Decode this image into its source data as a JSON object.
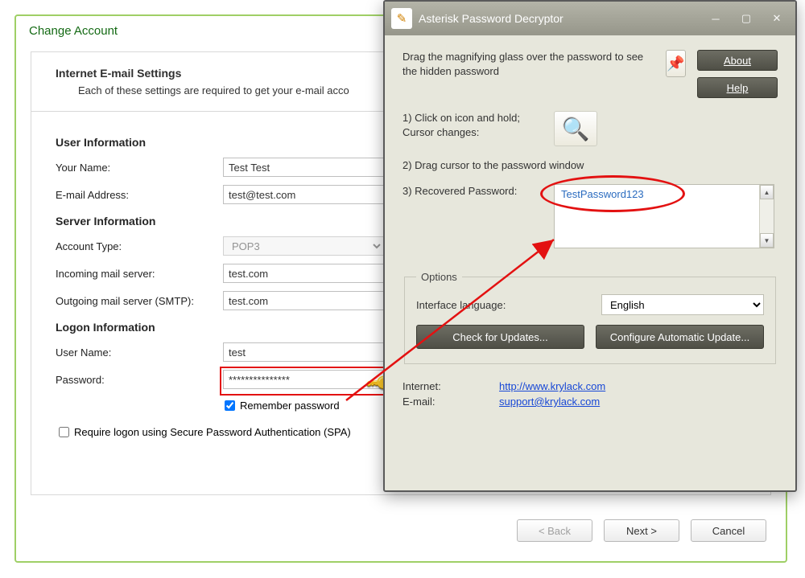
{
  "back": {
    "title": "Change Account",
    "header": "Internet E-mail Settings",
    "subheader": "Each of these settings are required to get your e-mail acco",
    "sections": {
      "user": "User Information",
      "server": "Server Information",
      "logon": "Logon Information"
    },
    "labels": {
      "your_name": "Your Name:",
      "email": "E-mail Address:",
      "account_type": "Account Type:",
      "incoming": "Incoming mail server:",
      "outgoing": "Outgoing mail server (SMTP):",
      "username": "User Name:",
      "password": "Password:",
      "remember": "Remember password",
      "spa": "Require logon using Secure Password Authentication (SPA)"
    },
    "values": {
      "your_name": "Test Test",
      "email": "test@test.com",
      "account_type": "POP3",
      "incoming": "test.com",
      "outgoing": "test.com",
      "username": "test",
      "password": "***************"
    },
    "buttons": {
      "back": "< Back",
      "next": "Next >",
      "cancel": "Cancel"
    },
    "checked": {
      "remember": true,
      "spa": false
    }
  },
  "front": {
    "title": "Asterisk Password Decryptor",
    "drag_desc": "Drag the magnifying glass over the password to see the hidden password",
    "about_label": "About",
    "help_label": "Help",
    "step1": "1) Click on icon and hold;\nCursor changes:",
    "step2": "2) Drag cursor to the password window",
    "step3_label": "3) Recovered Password:",
    "recovered": "TestPassword123",
    "options_legend": "Options",
    "lang_label": "Interface language:",
    "lang_value": "English",
    "check_updates": "Check for Updates...",
    "config_updates": "Configure Automatic Update...",
    "internet_label": "Internet:",
    "internet_link": "http://www.krylack.com",
    "email_label": "E-mail:",
    "email_link": "support@krylack.com",
    "icons": {
      "pin": "📌",
      "magnifier": "🔍",
      "key": "🔑",
      "pencil": "✎"
    }
  }
}
